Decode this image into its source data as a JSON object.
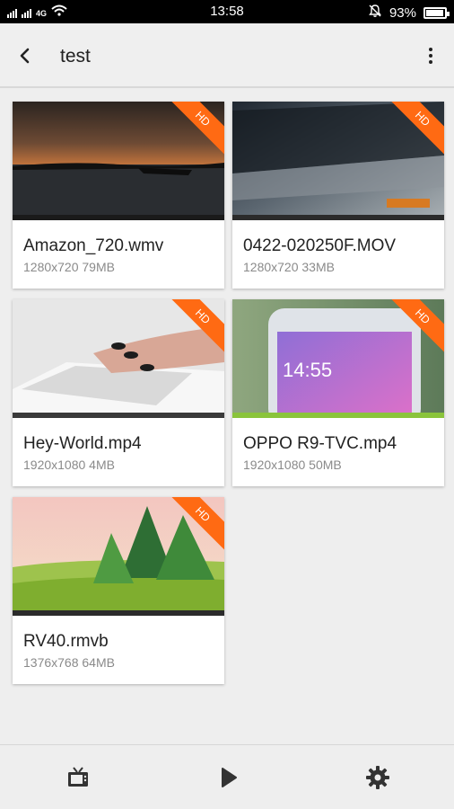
{
  "status": {
    "network": "4G",
    "time": "13:58",
    "battery": "93%",
    "battery_level": 0.93,
    "icons": [
      "signal-icon",
      "wifi-icon",
      "mute-bell-icon",
      "battery-icon"
    ]
  },
  "appbar": {
    "title": "test",
    "back_icon": "back-arrow-icon",
    "more_icon": "more-vert-icon"
  },
  "videos": [
    {
      "name": "Amazon_720.wmv",
      "meta": "1280x720  79MB",
      "badge": "HD"
    },
    {
      "name": "0422-020250F.MOV",
      "meta": "1280x720  33MB",
      "badge": "HD"
    },
    {
      "name": "Hey-World.mp4",
      "meta": "1920x1080  4MB",
      "badge": "HD"
    },
    {
      "name": "OPPO R9-TVC.mp4",
      "meta": "1920x1080  50MB",
      "badge": "HD"
    },
    {
      "name": "RV40.rmvb",
      "meta": "1376x768  64MB",
      "badge": "HD"
    }
  ],
  "bottom_nav": {
    "icons": [
      "tv-icon",
      "play-icon",
      "settings-gear-icon"
    ]
  },
  "colors": {
    "badge": "#ff6a13",
    "appbar": "#efefef",
    "background": "#eeeeee"
  }
}
